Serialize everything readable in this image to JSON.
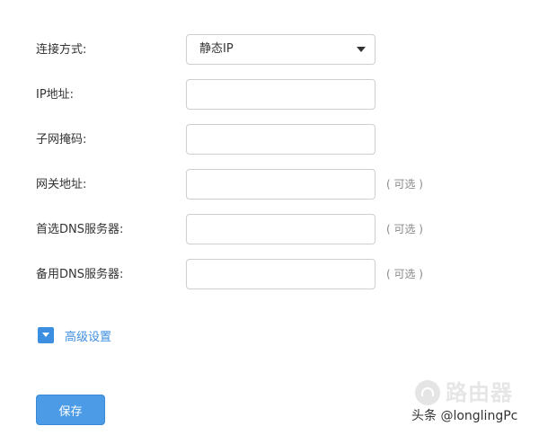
{
  "form": {
    "connection_type": {
      "label": "连接方式:",
      "selected": "静态IP"
    },
    "ip_address": {
      "label": "IP地址:",
      "value": ""
    },
    "subnet_mask": {
      "label": "子网掩码:",
      "value": ""
    },
    "gateway": {
      "label": "网关地址:",
      "value": "",
      "hint": "( 可选 )"
    },
    "primary_dns": {
      "label": "首选DNS服务器:",
      "value": "",
      "hint": "( 可选 )"
    },
    "secondary_dns": {
      "label": "备用DNS服务器:",
      "value": "",
      "hint": "( 可选 )"
    }
  },
  "advanced": {
    "label": "高级设置"
  },
  "actions": {
    "save_label": "保存"
  },
  "watermark": {
    "brand": "路由器",
    "credit": "头条 @longlingPc"
  },
  "colors": {
    "accent": "#4b9be6",
    "link": "#3c8ee0",
    "border": "#cfcfcf",
    "text": "#333333",
    "hint": "#888888"
  },
  "icons": {
    "select_caret": "chevron-down-icon",
    "advanced_toggle": "expand-down-icon",
    "watermark_logo": "router-logo-icon"
  }
}
